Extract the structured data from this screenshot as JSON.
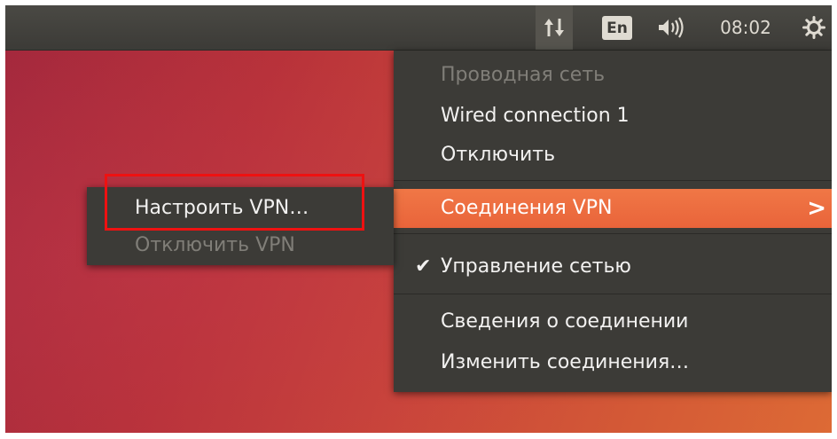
{
  "panel": {
    "keyboard_layout": "En",
    "clock": "08:02",
    "icons": [
      "network-updown-icon",
      "volume-icon",
      "session-gear-icon"
    ]
  },
  "network_menu": {
    "header": "Проводная сеть",
    "connection": "Wired connection 1",
    "disconnect": "Отключить",
    "vpn_connections": "Соединения VPN",
    "vpn_arrow": ">",
    "checkmark": "✔",
    "manage_network": "Управление сетью",
    "manage_network_checked": true,
    "connection_info": "Сведения о соединении",
    "edit_connections": "Изменить соединения…"
  },
  "vpn_submenu": {
    "configure_vpn": "Настроить VPN…",
    "disconnect_vpn": "Отключить VPN"
  },
  "colors": {
    "highlight": "#e9643a",
    "annotation_box": "#ee1111",
    "menu_bg": "#3c3b37"
  }
}
